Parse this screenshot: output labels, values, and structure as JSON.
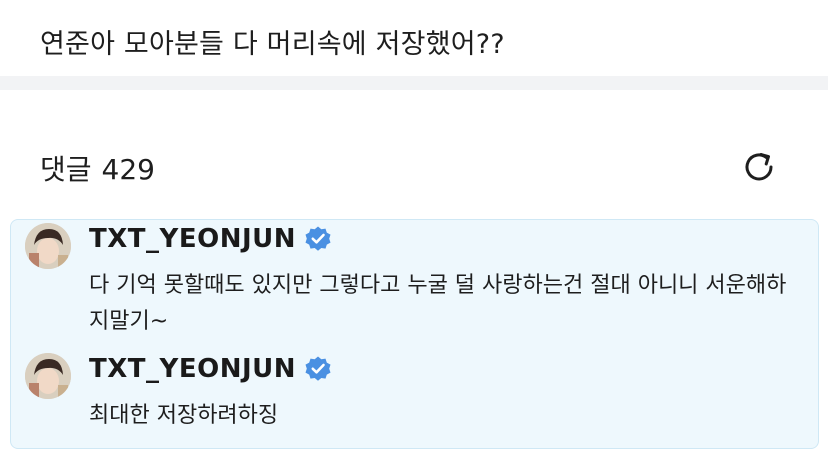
{
  "post": {
    "text": "연준아 모아분들 다 머리속에 저장했어??"
  },
  "comments_header": {
    "label": "댓글",
    "count": "429"
  },
  "icons": {
    "refresh": "refresh-icon",
    "verified": "verified-badge-icon"
  },
  "colors": {
    "thread_bg": "#eef8fd",
    "thread_border": "#cfe8f5",
    "verified": "#4a90e2"
  },
  "thread": {
    "comments": [
      {
        "username": "TXT_YEONJUN",
        "text": "다 기억 못할때도 있지만 그렇다고 누굴 덜 사랑하는건 절대 아니니 서운해하지말기~"
      },
      {
        "username": "TXT_YEONJUN",
        "text": "최대한 저장하려하징"
      }
    ]
  }
}
